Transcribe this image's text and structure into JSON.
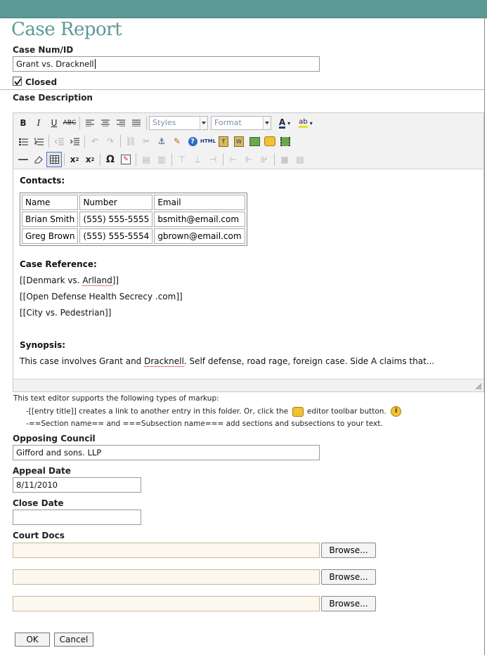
{
  "page": {
    "title": "Case Report"
  },
  "form": {
    "case_num_label": "Case Num/ID",
    "case_num_value": "Grant vs. Dracknell",
    "closed_label": "Closed",
    "closed_checked": true,
    "case_description_label": "Case Description"
  },
  "editor": {
    "styles_label": "Styles",
    "format_label": "Format",
    "html_label": "HTML",
    "contacts_heading": "Contacts:",
    "contacts_table": {
      "headers": [
        "Name",
        "Number",
        "Email"
      ],
      "rows": [
        [
          "Brian Smith",
          "(555) 555-5555",
          "bsmith@email.com"
        ],
        [
          "Greg Brown",
          "(555) 555-5554",
          "gbrown@email.com"
        ]
      ]
    },
    "case_reference_heading": "Case Reference:",
    "references": [
      {
        "before": "[[Denmark vs. ",
        "squiggle": "Arlland",
        "after": "]]"
      },
      "[[Open Defense Health Secrecy .com]]",
      "[[City vs. Pedestrian]]"
    ],
    "synopsis_heading": "Synopsis:",
    "synopsis": {
      "before": "This case involves Grant and ",
      "squiggle": "Dracknell",
      "after": ". Self defense, road rage, foreign case. Side A claims that..."
    }
  },
  "help": {
    "intro": "This text editor supports the following types of markup:",
    "line1_before": "-[[entry title]] creates a link to another entry in this folder. Or, click the",
    "line1_after": "editor toolbar button.",
    "line2": "-==Section name== and ===Subsection name=== add sections and subsections to your text."
  },
  "opposing_council": {
    "label": "Opposing Council",
    "value": "Gifford and sons. LLP"
  },
  "appeal_date": {
    "label": "Appeal Date",
    "value": "8/11/2010"
  },
  "close_date": {
    "label": "Close Date",
    "value": ""
  },
  "court_docs": {
    "label": "Court Docs",
    "browse_label": "Browse..."
  },
  "buttons": {
    "ok": "OK",
    "cancel": "Cancel"
  },
  "colors": {
    "accent": "#5a9a96"
  }
}
